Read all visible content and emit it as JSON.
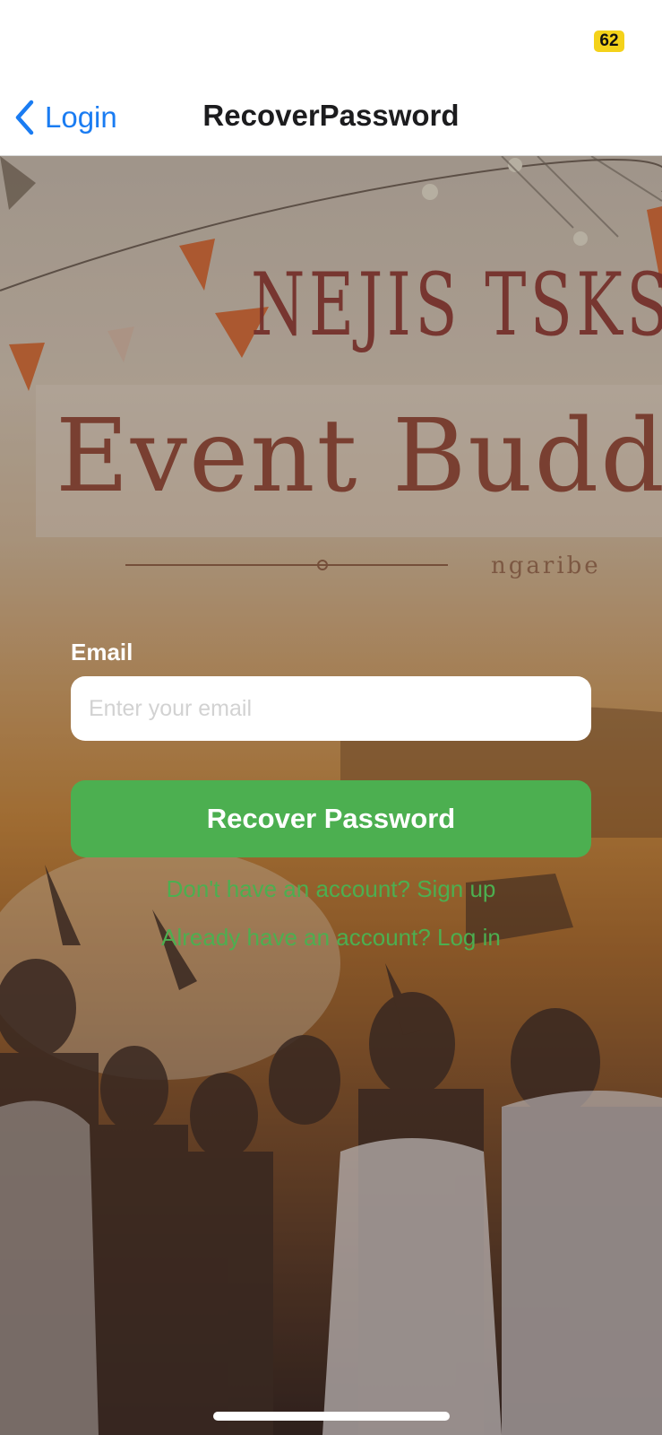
{
  "status_bar": {
    "battery_level": "62",
    "battery_color": "#f4d21a"
  },
  "nav": {
    "back_label": "Login",
    "back_icon": "chevron-left-icon",
    "title": "RecoverPassword"
  },
  "hero": {
    "logo_top": "NEJIS TSKS",
    "logo_main": "Event Buddy",
    "logo_sub": "ngaribe"
  },
  "form": {
    "email_label": "Email",
    "email_placeholder": "Enter your email",
    "email_value": "",
    "recover_button_label": "Recover Password",
    "signup_link": "Don't have an account? Sign up",
    "login_link": "Already have an account? Log in"
  },
  "colors": {
    "accent_blue": "#1a7cf2",
    "primary_green": "#4caf50",
    "label_white": "#ffffff"
  }
}
